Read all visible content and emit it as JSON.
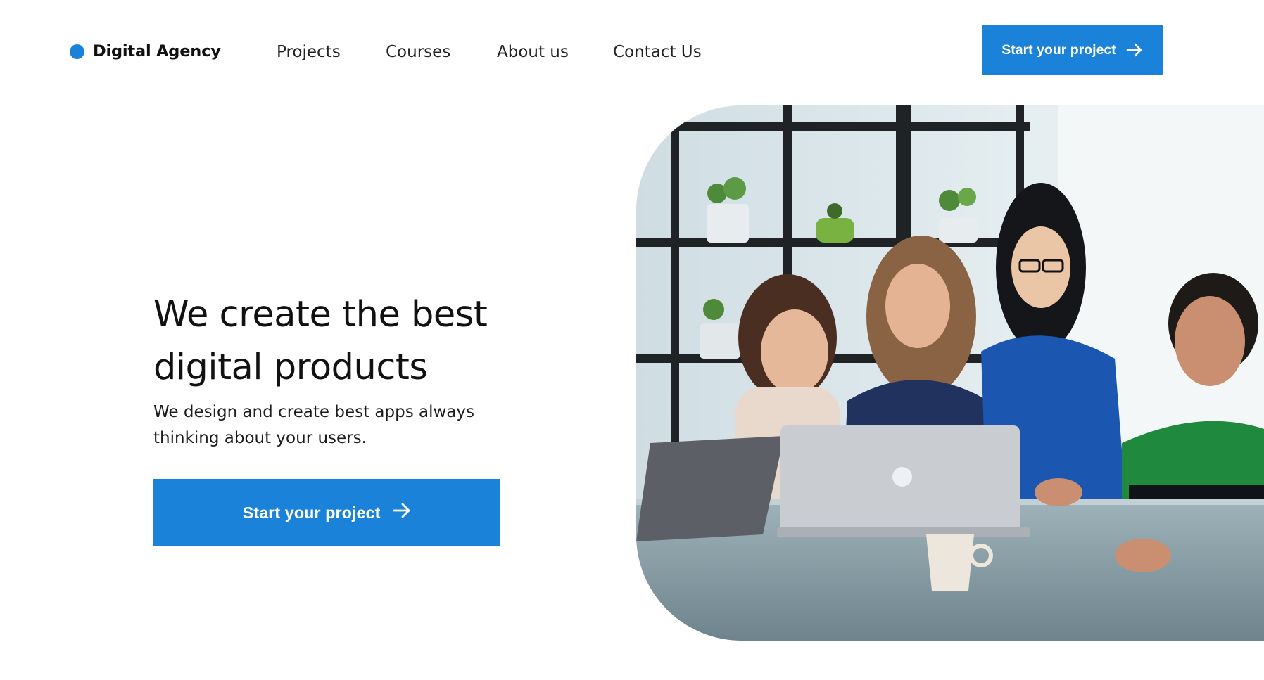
{
  "header": {
    "logo_text": "Digital Agency",
    "nav": [
      {
        "label": "Projects"
      },
      {
        "label": "Courses"
      },
      {
        "label": "About us"
      },
      {
        "label": "Contact Us"
      }
    ],
    "cta_label": "Start your project",
    "cta_icon": "arrow-right-icon"
  },
  "hero": {
    "title": "We create the best digital products",
    "subtitle": "We design and create best apps always thinking about your users.",
    "cta_label": "Start your project",
    "cta_icon": "arrow-right-icon",
    "photo_subject": "team of four people around a laptop"
  },
  "colors": {
    "accent": "#1a82d8",
    "text": "#111111",
    "background": "#ffffff"
  }
}
